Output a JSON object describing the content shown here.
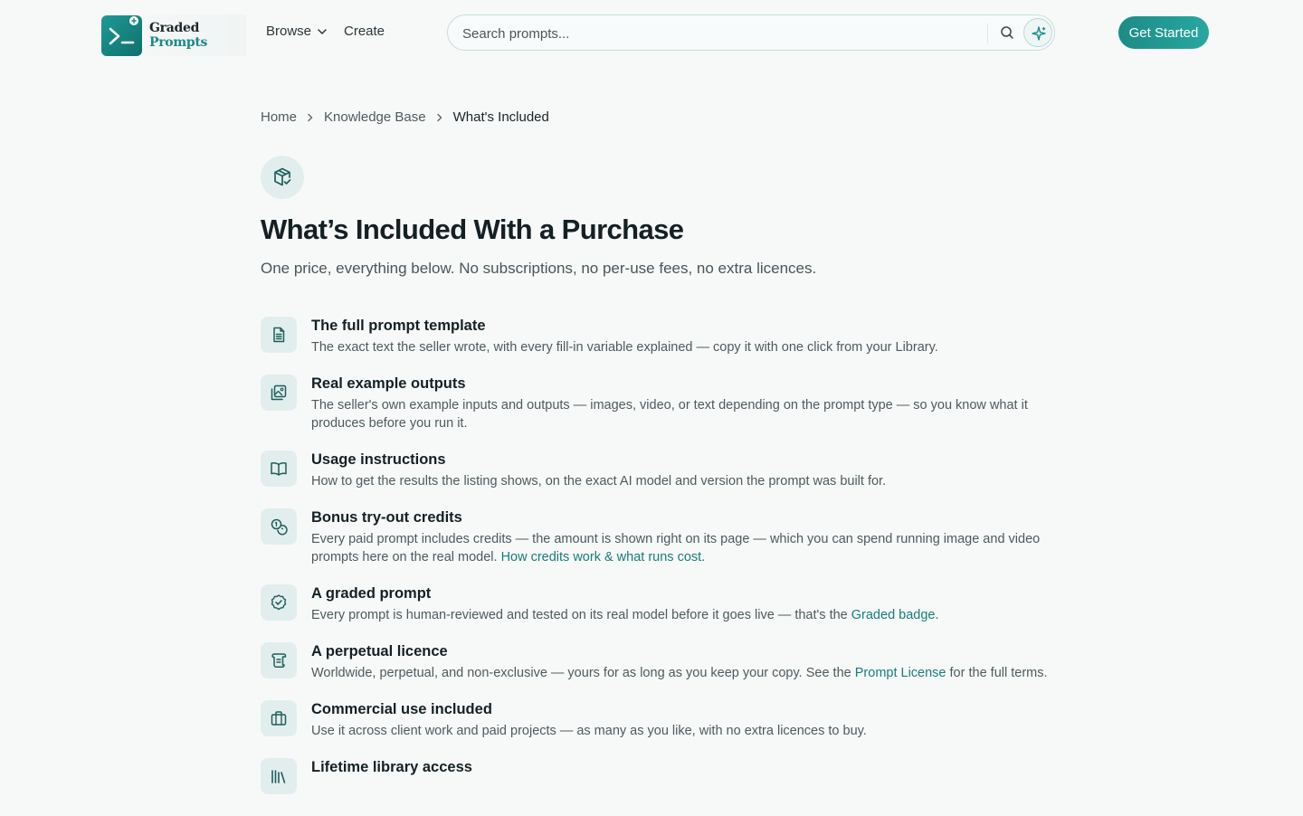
{
  "brand": {
    "line1": "Graded",
    "line2": "Prompts"
  },
  "nav": {
    "browse": "Browse",
    "create": "Create"
  },
  "search": {
    "placeholder": "Search prompts..."
  },
  "header": {
    "cta": "Get Started"
  },
  "breadcrumb": {
    "home": "Home",
    "kb": "Knowledge Base",
    "current": "What's Included"
  },
  "page": {
    "title": "What’s Included With a Purchase",
    "subtitle": "One price, everything below. No subscriptions, no per-use fees, no extra licences."
  },
  "features": [
    {
      "icon": "document-icon",
      "title": "The full prompt template",
      "desc": "The exact text the seller wrote, with every fill-in variable explained — copy it with one click from your Library."
    },
    {
      "icon": "images-icon",
      "title": "Real example outputs",
      "desc": "The seller's own example inputs and outputs — images, video, or text depending on the prompt type — so you know what it produces before you run it."
    },
    {
      "icon": "book-icon",
      "title": "Usage instructions",
      "desc": "How to get the results the listing shows, on the exact AI model and version the prompt was built for."
    },
    {
      "icon": "coins-icon",
      "title": "Bonus try-out credits",
      "desc": "Every paid prompt includes credits — the amount is shown right on its page — which you can spend running image and video prompts here on the real model.",
      "link": "How credits work & what runs cost",
      "after": "."
    },
    {
      "icon": "check-badge-icon",
      "title": "A graded prompt",
      "desc": "Every prompt is human-reviewed and tested on its real model before it goes live — that's the",
      "link": "Graded badge",
      "after": "."
    },
    {
      "icon": "scroll-icon",
      "title": "A perpetual licence",
      "desc": "Worldwide, perpetual, and non-exclusive — yours for as long as you keep your copy. See the",
      "link": "Prompt License",
      "after": " for the full terms."
    },
    {
      "icon": "briefcase-icon",
      "title": "Commercial use included",
      "desc": "Use it across client work and paid projects — as many as you like, with no extra licences to buy."
    },
    {
      "icon": "library-icon",
      "title": "Lifetime library access",
      "desc": ""
    }
  ]
}
